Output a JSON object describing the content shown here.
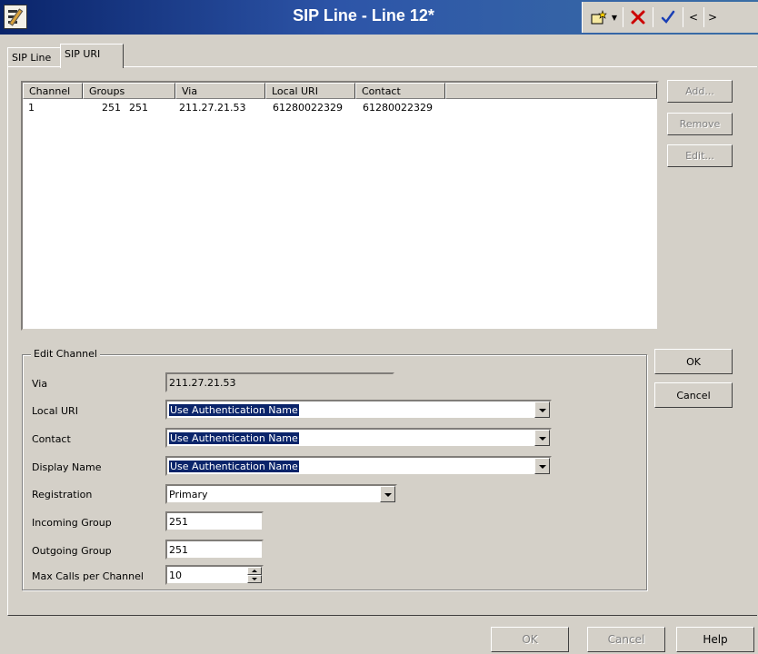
{
  "window": {
    "title": "SIP Line - Line 12*"
  },
  "toolbar": {
    "new_icon": "new-document-icon",
    "delete_icon": "delete-x-icon",
    "confirm_icon": "checkmark-icon",
    "prev_label": "<",
    "next_label": ">",
    "delete_color": "#cc0000",
    "confirm_color": "#1a3fb5"
  },
  "tabs": [
    {
      "label": "SIP Line",
      "active": false
    },
    {
      "label": "SIP URI",
      "active": true
    }
  ],
  "table": {
    "columns": [
      "Channel",
      "Groups",
      "Via",
      "Local URI",
      "Contact"
    ],
    "rows": [
      {
        "channel": "1",
        "groups_in": "251",
        "groups_out": "251",
        "via": "211.27.21.53",
        "local_uri": "61280022329",
        "contact": "61280022329"
      }
    ]
  },
  "side_buttons": {
    "add": "Add...",
    "remove": "Remove",
    "edit": "Edit..."
  },
  "edit_channel": {
    "title": "Edit Channel",
    "via_label": "Via",
    "via_value": "211.27.21.53",
    "local_uri_label": "Local URI",
    "local_uri_value": "Use Authentication Name",
    "contact_label": "Contact",
    "contact_value": "Use Authentication Name",
    "display_name_label": "Display Name",
    "display_name_value": "Use Authentication Name",
    "registration_label": "Registration",
    "registration_value": "Primary",
    "incoming_group_label": "Incoming Group",
    "incoming_group_value": "251",
    "outgoing_group_label": "Outgoing Group",
    "outgoing_group_value": "251",
    "max_calls_label": "Max Calls per Channel",
    "max_calls_value": "10"
  },
  "edit_buttons": {
    "ok": "OK",
    "cancel": "Cancel"
  },
  "footer_buttons": {
    "ok": "OK",
    "cancel": "Cancel",
    "help": "Help"
  }
}
